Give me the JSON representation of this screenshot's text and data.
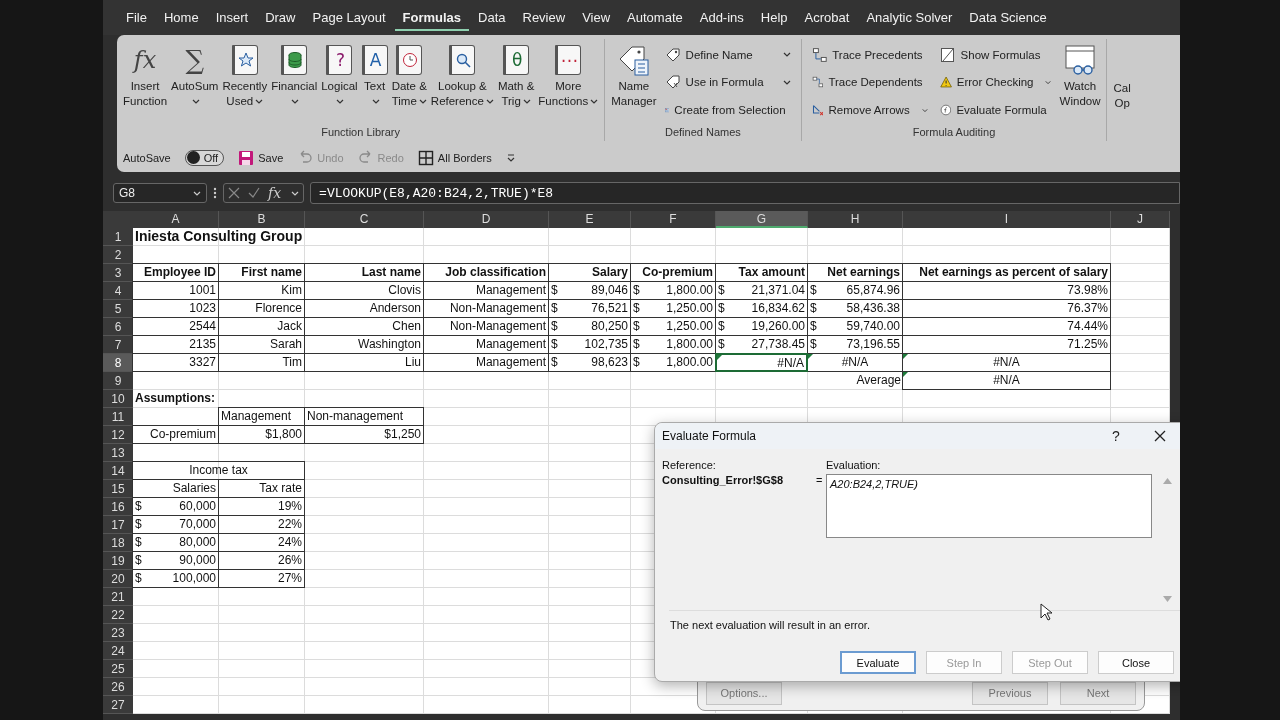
{
  "menu_tabs": [
    {
      "label": "File",
      "selected": false
    },
    {
      "label": "Home",
      "selected": false
    },
    {
      "label": "Insert",
      "selected": false
    },
    {
      "label": "Draw",
      "selected": false
    },
    {
      "label": "Page Layout",
      "selected": false
    },
    {
      "label": "Formulas",
      "selected": true
    },
    {
      "label": "Data",
      "selected": false
    },
    {
      "label": "Review",
      "selected": false
    },
    {
      "label": "View",
      "selected": false
    },
    {
      "label": "Automate",
      "selected": false
    },
    {
      "label": "Add-ins",
      "selected": false
    },
    {
      "label": "Help",
      "selected": false
    },
    {
      "label": "Acrobat",
      "selected": false
    },
    {
      "label": "Analytic Solver",
      "selected": false
    },
    {
      "label": "Data Science",
      "selected": false
    }
  ],
  "function_library": {
    "label": "Function Library",
    "buttons": [
      {
        "kind": "fx",
        "glyph": "fx",
        "lines": [
          "Insert",
          "Function"
        ],
        "dropdown": false
      },
      {
        "kind": "sum",
        "glyph": "∑",
        "lines": [
          "AutoSum"
        ],
        "dropdown": true
      },
      {
        "kind": "star",
        "lines": [
          "Recently",
          "Used"
        ],
        "dropdown": true
      },
      {
        "kind": "coins",
        "lines": [
          "Financial"
        ],
        "dropdown": true
      },
      {
        "kind": "book",
        "glyph": "?",
        "color": "#8b1a6b",
        "lines": [
          "Logical"
        ],
        "dropdown": true
      },
      {
        "kind": "book",
        "glyph": "A",
        "color": "#1f5fa8",
        "lines": [
          "Text"
        ],
        "dropdown": true
      },
      {
        "kind": "clock",
        "lines": [
          "Date &",
          "Time"
        ],
        "dropdown": true
      },
      {
        "kind": "search",
        "lines": [
          "Lookup &",
          "Reference"
        ],
        "dropdown": true
      },
      {
        "kind": "book",
        "glyph": "θ",
        "color": "#1d6b35",
        "lines": [
          "Math &",
          "Trig"
        ],
        "dropdown": true
      },
      {
        "kind": "book",
        "glyph": "⋯",
        "color": "#c0243a",
        "lines": [
          "More",
          "Functions"
        ],
        "dropdown": true
      }
    ]
  },
  "defined_names": {
    "label": "Defined Names",
    "big_button": {
      "kind": "namemanager",
      "lines": [
        "Name",
        "Manager"
      ]
    },
    "items": [
      {
        "kind": "tag",
        "label": "Define Name",
        "dropdown": true
      },
      {
        "kind": "tagfx",
        "label": "Use in Formula",
        "dropdown": true
      },
      {
        "kind": "grid",
        "label": "Create from Selection",
        "dropdown": false
      }
    ]
  },
  "formula_auditing": {
    "label": "Formula Auditing",
    "items": [
      {
        "kind": "precedents",
        "label": "Trace Precedents",
        "dropdown": false
      },
      {
        "kind": "dependents",
        "label": "Trace Dependents",
        "dropdown": false
      },
      {
        "kind": "removearrows",
        "label": "Remove Arrows",
        "dropdown": true
      },
      {
        "kind": "showformulas",
        "label": "Show Formulas",
        "dropdown": false
      },
      {
        "kind": "warning",
        "label": "Error Checking",
        "dropdown": true
      },
      {
        "kind": "evaluate",
        "label": "Evaluate Formula",
        "dropdown": false
      }
    ],
    "big_button": {
      "kind": "watch",
      "lines": [
        "Watch",
        "Window"
      ]
    }
  },
  "cut_button": {
    "lines": [
      "Cal",
      "Op"
    ]
  },
  "quick_access": [
    {
      "kind": "toggle",
      "label": "AutoSave",
      "on": false,
      "state_text": "Off"
    },
    {
      "kind": "save",
      "label": "Save",
      "disabled": false
    },
    {
      "kind": "undo",
      "label": "Undo",
      "disabled": true
    },
    {
      "kind": "redo",
      "label": "Redo",
      "disabled": true
    },
    {
      "kind": "borders",
      "label": "All Borders",
      "disabled": false
    },
    {
      "kind": "customize"
    }
  ],
  "formula_bar": {
    "name_box": "G8",
    "function_glyph": "fx",
    "formula": "=VLOOKUP(E8,A20:B24,2,TRUE)*E8"
  },
  "sheet": {
    "columns": [
      "A",
      "B",
      "C",
      "D",
      "E",
      "F",
      "G",
      "H",
      "I",
      "J"
    ],
    "rows": [
      {
        "number": "1",
        "cells": [
          {
            "kind": "title",
            "text": "Iniesta Consulting Group",
            "selected": false
          }
        ]
      },
      {
        "number": "2"
      },
      {
        "number": "3",
        "cells": [
          {
            "kind": "header",
            "text": "Employee ID",
            "boxed": true,
            "selected": false
          },
          {
            "kind": "header",
            "text": "First name",
            "boxed": true,
            "selected": false
          },
          {
            "kind": "header",
            "text": "Last name",
            "boxed": true,
            "selected": false
          },
          {
            "kind": "header",
            "text": "Job classification",
            "boxed": true,
            "selected": false
          },
          {
            "kind": "header",
            "text": "Salary",
            "boxed": true,
            "selected": false
          },
          {
            "kind": "header",
            "text": "Co-premium",
            "boxed": true,
            "selected": false
          },
          {
            "kind": "header",
            "text": "Tax amount",
            "boxed": true,
            "selected": false
          },
          {
            "kind": "header",
            "text": "Net earnings",
            "boxed": true,
            "selected": false
          },
          {
            "kind": "header",
            "text": "Net earnings as percent of salary",
            "boxed": true,
            "selected": false
          }
        ]
      },
      {
        "number": "4",
        "cells": [
          {
            "kind": "value",
            "text": "1001",
            "boxed": true,
            "selected": false
          },
          {
            "kind": "value",
            "text": "Kim",
            "boxed": true,
            "selected": false
          },
          {
            "kind": "value",
            "text": "Clovis",
            "boxed": true,
            "selected": false
          },
          {
            "kind": "value",
            "text": "Management",
            "boxed": true,
            "selected": false
          },
          {
            "kind": "value",
            "currency": "$",
            "text": "89,046",
            "boxed": true,
            "selected": false
          },
          {
            "kind": "value",
            "currency": "$",
            "text": "1,800.00",
            "boxed": true,
            "selected": false
          },
          {
            "kind": "value",
            "currency": "$",
            "text": "21,371.04",
            "boxed": true,
            "selected": false
          },
          {
            "kind": "value",
            "currency": "$",
            "text": "65,874.96",
            "boxed": true,
            "selected": false
          },
          {
            "kind": "value",
            "text": "73.98%",
            "boxed": true,
            "selected": false
          }
        ]
      },
      {
        "number": "5",
        "cells": [
          {
            "kind": "value",
            "text": "1023",
            "boxed": true,
            "selected": false
          },
          {
            "kind": "value",
            "text": "Florence",
            "boxed": true,
            "selected": false
          },
          {
            "kind": "value",
            "text": "Anderson",
            "boxed": true,
            "selected": false
          },
          {
            "kind": "value",
            "text": "Non-Management",
            "boxed": true,
            "selected": false
          },
          {
            "kind": "value",
            "currency": "$",
            "text": "76,521",
            "boxed": true,
            "selected": false
          },
          {
            "kind": "value",
            "currency": "$",
            "text": "1,250.00",
            "boxed": true,
            "selected": false
          },
          {
            "kind": "value",
            "currency": "$",
            "text": "16,834.62",
            "boxed": true,
            "selected": false
          },
          {
            "kind": "value",
            "currency": "$",
            "text": "58,436.38",
            "boxed": true,
            "selected": false
          },
          {
            "kind": "value",
            "text": "76.37%",
            "boxed": true,
            "selected": false
          }
        ]
      },
      {
        "number": "6",
        "cells": [
          {
            "kind": "value",
            "text": "2544",
            "boxed": true,
            "selected": false
          },
          {
            "kind": "value",
            "text": "Jack",
            "boxed": true,
            "selected": false
          },
          {
            "kind": "value",
            "text": "Chen",
            "boxed": true,
            "selected": false
          },
          {
            "kind": "value",
            "text": "Non-Management",
            "boxed": true,
            "selected": false
          },
          {
            "kind": "value",
            "currency": "$",
            "text": "80,250",
            "boxed": true,
            "selected": false
          },
          {
            "kind": "value",
            "currency": "$",
            "text": "1,250.00",
            "boxed": true,
            "selected": false
          },
          {
            "kind": "value",
            "currency": "$",
            "text": "19,260.00",
            "boxed": true,
            "selected": false
          },
          {
            "kind": "value",
            "currency": "$",
            "text": "59,740.00",
            "boxed": true,
            "selected": false
          },
          {
            "kind": "value",
            "text": "74.44%",
            "boxed": true,
            "selected": false
          }
        ]
      },
      {
        "number": "7",
        "cells": [
          {
            "kind": "value",
            "text": "2135",
            "boxed": true,
            "selected": false
          },
          {
            "kind": "value",
            "text": "Sarah",
            "boxed": true,
            "selected": false
          },
          {
            "kind": "value",
            "text": "Washington",
            "boxed": true,
            "selected": false
          },
          {
            "kind": "value",
            "text": "Management",
            "boxed": true,
            "selected": false
          },
          {
            "kind": "value",
            "currency": "$",
            "text": "102,735",
            "boxed": true,
            "selected": false
          },
          {
            "kind": "value",
            "currency": "$",
            "text": "1,800.00",
            "boxed": true,
            "selected": false
          },
          {
            "kind": "value",
            "currency": "$",
            "text": "27,738.45",
            "boxed": true,
            "selected": false
          },
          {
            "kind": "value",
            "currency": "$",
            "text": "73,196.55",
            "boxed": true,
            "selected": false
          },
          {
            "kind": "value",
            "text": "71.25%",
            "boxed": true,
            "selected": false
          }
        ]
      },
      {
        "number": "8",
        "cells": [
          {
            "kind": "value",
            "text": "3327",
            "boxed": true,
            "selected": false
          },
          {
            "kind": "value",
            "text": "Tim",
            "boxed": true,
            "selected": false
          },
          {
            "kind": "value",
            "text": "Liu",
            "boxed": true,
            "selected": false
          },
          {
            "kind": "value",
            "text": "Management",
            "boxed": true,
            "selected": false
          },
          {
            "kind": "value",
            "currency": "$",
            "text": "98,623",
            "boxed": true,
            "selected": false
          },
          {
            "kind": "value",
            "currency": "$",
            "text": "1,800.00",
            "boxed": true,
            "selected": false
          },
          {
            "kind": "value",
            "text": "#N/A",
            "boxed": true,
            "error_flag": true,
            "selected": true
          },
          {
            "kind": "centered",
            "text": "#N/A",
            "boxed": true,
            "error_flag": true,
            "selected": false
          },
          {
            "kind": "centered",
            "text": "#N/A",
            "boxed": true,
            "error_flag": true,
            "selected": false
          }
        ]
      },
      {
        "number": "9",
        "cells": [
          null,
          null,
          null,
          null,
          null,
          null,
          null,
          {
            "kind": "value",
            "text": "Average",
            "selected": false
          },
          {
            "kind": "centered",
            "text": "#N/A",
            "boxed": true,
            "error_flag": true,
            "selected": false
          }
        ]
      },
      {
        "number": "10",
        "cells": [
          {
            "kind": "heading",
            "text": "Assumptions:",
            "selected": false
          }
        ]
      },
      {
        "number": "11",
        "cells": [
          null,
          {
            "kind": "label",
            "text": "Management",
            "boxed": true,
            "selected": false
          },
          {
            "kind": "label",
            "text": "Non-management",
            "boxed": true,
            "selected": false
          }
        ]
      },
      {
        "number": "12",
        "cells": [
          {
            "kind": "value",
            "text": "Co-premium",
            "boxed": true,
            "selected": false
          },
          {
            "kind": "value",
            "text": "$1,800",
            "boxed": true,
            "selected": false
          },
          {
            "kind": "value",
            "text": "$1,250",
            "boxed": true,
            "selected": false
          }
        ]
      },
      {
        "number": "13"
      },
      {
        "number": "14",
        "cells": [
          {
            "kind": "merged",
            "text": "Income tax",
            "boxed": true,
            "selected": false
          }
        ]
      },
      {
        "number": "15",
        "cells": [
          {
            "kind": "value",
            "text": "Salaries",
            "boxed": true,
            "selected": false
          },
          {
            "kind": "value",
            "text": "Tax rate",
            "boxed": true,
            "selected": false
          }
        ]
      },
      {
        "number": "16",
        "cells": [
          {
            "kind": "value",
            "currency": "$",
            "text": "60,000",
            "boxed": true,
            "selected": false
          },
          {
            "kind": "value",
            "text": "19%",
            "boxed": true,
            "selected": false
          }
        ]
      },
      {
        "number": "17",
        "cells": [
          {
            "kind": "value",
            "currency": "$",
            "text": "70,000",
            "boxed": true,
            "selected": false
          },
          {
            "kind": "value",
            "text": "22%",
            "boxed": true,
            "selected": false
          }
        ]
      },
      {
        "number": "18",
        "cells": [
          {
            "kind": "value",
            "currency": "$",
            "text": "80,000",
            "boxed": true,
            "selected": false
          },
          {
            "kind": "value",
            "text": "24%",
            "boxed": true,
            "selected": false
          }
        ]
      },
      {
        "number": "19",
        "cells": [
          {
            "kind": "value",
            "currency": "$",
            "text": "90,000",
            "boxed": true,
            "selected": false
          },
          {
            "kind": "value",
            "text": "26%",
            "boxed": true,
            "selected": false
          }
        ]
      },
      {
        "number": "20",
        "cells": [
          {
            "kind": "value",
            "currency": "$",
            "text": "100,000",
            "boxed": true,
            "selected": false
          },
          {
            "kind": "value",
            "text": "27%",
            "boxed": true,
            "selected": false
          }
        ]
      },
      {
        "number": "21"
      },
      {
        "number": "22"
      },
      {
        "number": "23"
      },
      {
        "number": "24"
      },
      {
        "number": "25"
      },
      {
        "number": "26"
      },
      {
        "number": "27"
      }
    ]
  },
  "find_dialog": {
    "buttons": [
      "Options...",
      "Previous",
      "Next"
    ]
  },
  "evaluate_dialog": {
    "title": "Evaluate Formula",
    "help": "?",
    "reference_label": "Reference:",
    "reference": "Consulting_Error!$G$8",
    "equals": "=",
    "evaluation_label": "Evaluation:",
    "evaluation": "A20:B24,2,TRUE)",
    "message": "The next evaluation will result in an error.",
    "buttons": [
      {
        "label": "Evaluate",
        "default": true,
        "disabled": false
      },
      {
        "label": "Step In",
        "default": false,
        "disabled": true
      },
      {
        "label": "Step Out",
        "default": false,
        "disabled": true
      },
      {
        "label": "Close",
        "default": false,
        "disabled": false
      }
    ]
  }
}
